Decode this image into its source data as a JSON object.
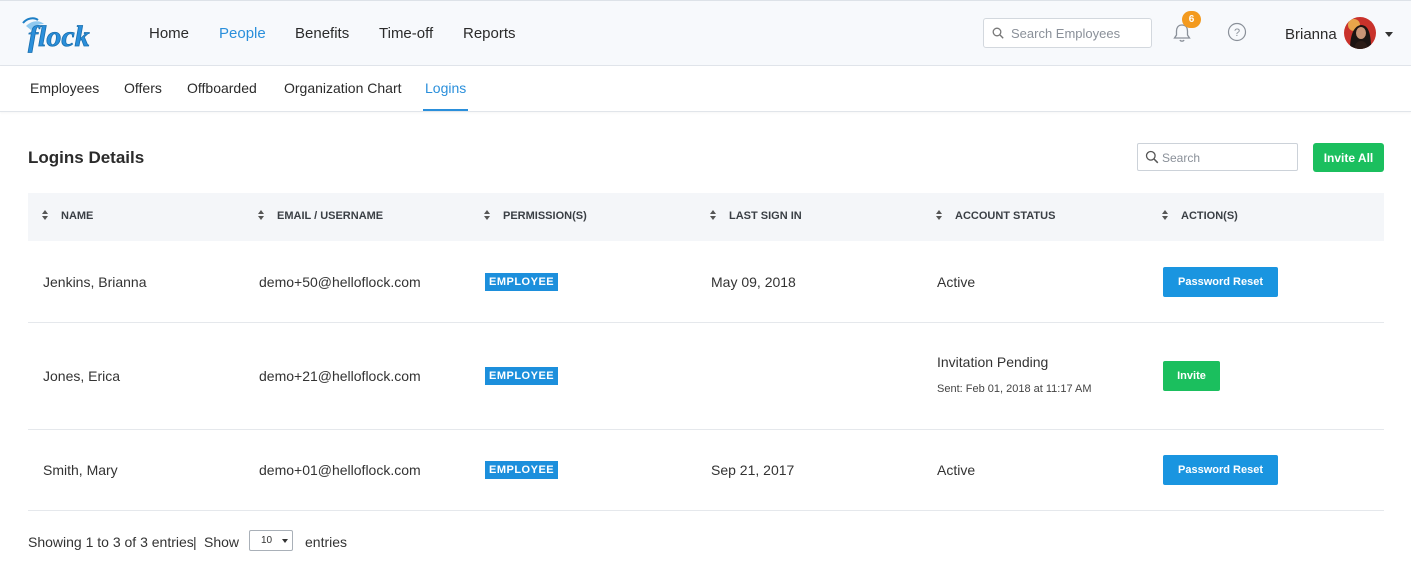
{
  "header": {
    "logo_text": "flock",
    "nav": [
      {
        "label": "Home",
        "active": false
      },
      {
        "label": "People",
        "active": true
      },
      {
        "label": "Benefits",
        "active": false
      },
      {
        "label": "Time-off",
        "active": false
      },
      {
        "label": "Reports",
        "active": false
      }
    ],
    "search_placeholder": "Search Employees",
    "notification_count": "6",
    "user_name": "Brianna"
  },
  "subnav": {
    "items": [
      {
        "label": "Employees",
        "active": false
      },
      {
        "label": "Offers",
        "active": false
      },
      {
        "label": "Offboarded",
        "active": false
      },
      {
        "label": "Organization Chart",
        "active": false
      },
      {
        "label": "Logins",
        "active": true
      }
    ]
  },
  "main": {
    "title": "Logins Details",
    "search_placeholder": "Search",
    "invite_all_label": "Invite All",
    "columns": [
      "NAME",
      "EMAIL / USERNAME",
      "PERMISSION(S)",
      "LAST SIGN IN",
      "ACCOUNT STATUS",
      "ACTION(S)"
    ],
    "rows": [
      {
        "name": "Jenkins, Brianna",
        "email": "demo+50@helloflock.com",
        "permission": "EMPLOYEE",
        "last_sign_in": "May 09, 2018",
        "status": "Active",
        "status_note": "",
        "action": "Password Reset"
      },
      {
        "name": "Jones, Erica",
        "email": "demo+21@helloflock.com",
        "permission": "EMPLOYEE",
        "last_sign_in": "",
        "status": "Invitation Pending",
        "status_note": "Sent: Feb 01, 2018 at 11:17 AM",
        "action": "Invite"
      },
      {
        "name": "Smith, Mary",
        "email": "demo+01@helloflock.com",
        "permission": "EMPLOYEE",
        "last_sign_in": "Sep 21, 2017",
        "status": "Active",
        "status_note": "",
        "action": "Password Reset"
      }
    ],
    "footer": {
      "showing": "Showing 1 to 3 of 3 entries",
      "separator": "|",
      "show_label": "Show",
      "page_size": "10",
      "entries_label": "entries"
    }
  },
  "colors": {
    "accent_blue": "#2a8fdb",
    "primary_button": "#1a95e0",
    "success_green": "#1bbf5e",
    "badge_orange": "#f39a1f",
    "tag_blue": "#1c8fdc"
  },
  "icons": [
    "search-icon",
    "bell-icon",
    "help-icon",
    "sort-icon",
    "chevron-down-icon"
  ]
}
